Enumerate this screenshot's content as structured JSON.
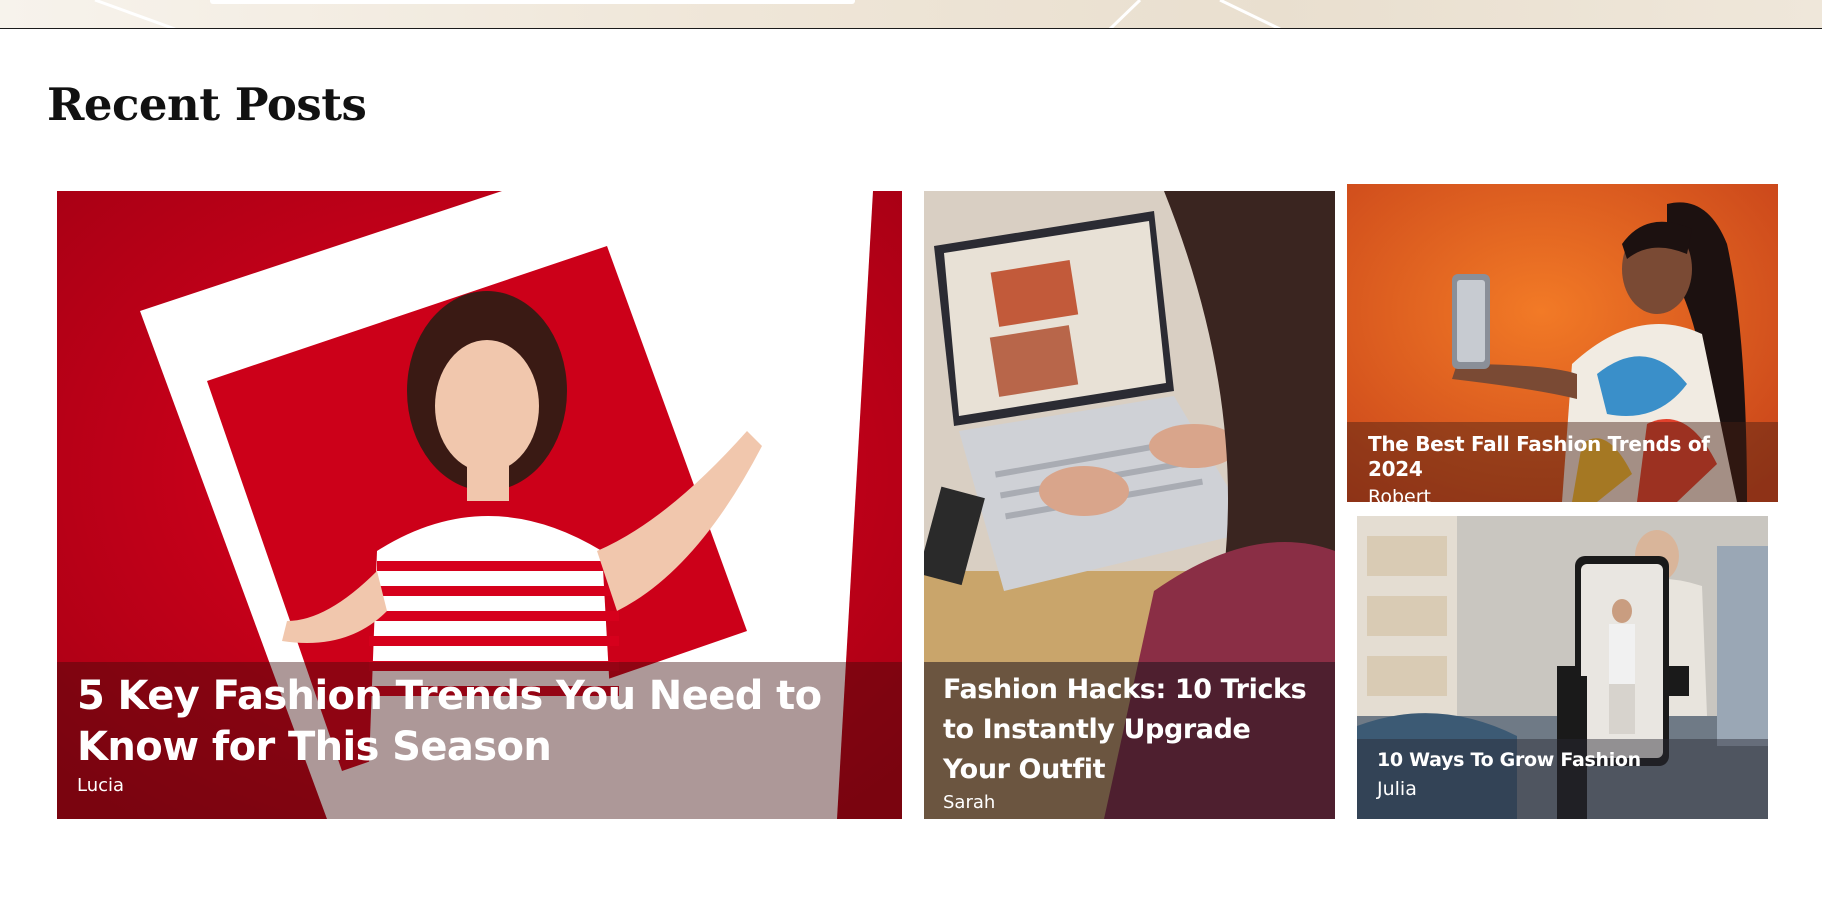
{
  "section": {
    "title": "Recent Posts"
  },
  "posts": [
    {
      "title": "5 Key Fashion Trends You Need to Know for This Season",
      "author": "Lucia",
      "image": "woman-with-picture-frame-red-background"
    },
    {
      "title": "Fashion Hacks: 10 Tricks to Instantly Upgrade Your Outfit",
      "author": "Sarah",
      "image": "person-typing-on-laptop"
    },
    {
      "title": "The Best Fall Fashion Trends of 2024",
      "author": "Robert",
      "image": "woman-taking-selfie-orange-background"
    },
    {
      "title": "10 Ways To Grow Fashion",
      "author": "Julia",
      "image": "phone-on-tripod-recording-fashion"
    }
  ],
  "colors": {
    "card1_bg": "#c8001a",
    "card3_bg": "#e8631c",
    "overlay_text": "#ffffff",
    "heading": "#111111"
  }
}
